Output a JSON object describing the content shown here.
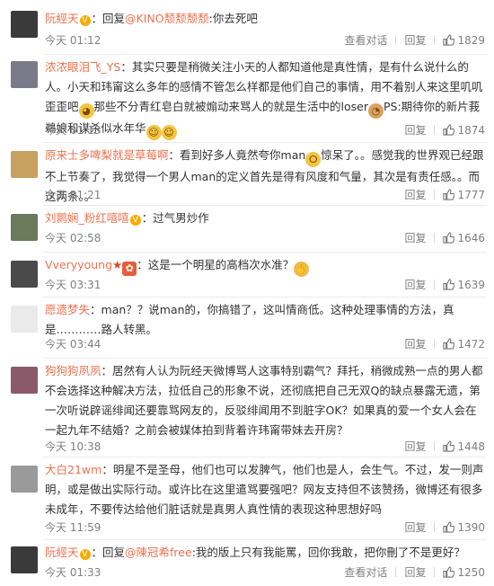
{
  "actions": {
    "view": "查看对话",
    "reply": "回复"
  },
  "comments": [
    {
      "avatar_color": "#3a3a3a",
      "name": "阮經天",
      "has_v": true,
      "text": "：回复",
      "mention": "@KINO颓颓颓颓",
      "text2": ":你去死吧",
      "time": "今天 01:12",
      "show_view": true,
      "likes": "1829"
    },
    {
      "avatar_color": "#7a7a8a",
      "name": "浓浓眼泪飞_YS",
      "text": "：其实只要是稍微关注小天的人都知道他是真性情，是有什么说什么的人。小天和玮甯这么多年的感情不管怎么样都是他们自己的事情，用不着别人来这里叽叽歪歪吧",
      "text2": "那些不分青红皂白就被煽动来骂人的就是生活中的loser",
      "text3": "PS:期待你的新片莪鵜娘和谋杀似水年华",
      "time": "今天 01:13",
      "show_view": false,
      "likes": "1874"
    },
    {
      "avatar_color": "#c8a060",
      "name": "原来士多啤梨就是草莓啊",
      "text": "：看到好多人竟然夸你man",
      "text2": "惊呆了。。感觉我的世界观已经跟不上节奏了，我觉得一个男人man的定义首先是得有风度和气量，其次是有责任感。。而这两条。。",
      "time": "今天 01:21",
      "show_view": false,
      "likes": "1777"
    },
    {
      "avatar_color": "#6a7a5a",
      "name": "刘鹮娴_粉红嘻嘻",
      "has_v": true,
      "text": "：过气男炒作",
      "time": "今天 02:58",
      "show_view": false,
      "likes": "1646"
    },
    {
      "avatar_color": "#4a4a4a",
      "name": "Vveryyoung",
      "text": "：这是一个明星的高档次水准？",
      "time": "今天 03:31",
      "show_view": false,
      "likes": "1639"
    },
    {
      "avatar_color": "#eaeaea",
      "name": "愿遗梦失",
      "text": "：man？？说man的，你搞错了，这叫情商低。这种处理事情的方法，真是…………路人转黑。",
      "time": "今天 03:44",
      "show_view": false,
      "likes": "1472"
    },
    {
      "avatar_color": "#8a5a6a",
      "name": "狗狗狗夙夙",
      "text": "：居然有人认为阮经天微博骂人这事特别霸气？拜托，稍微成熟一点的男人都不会选择这种解决方法，拉低自己的形象不说，还彻底把自己无双Q的缺点暴露无遗，第一次听说辟谣绯闻还要靠骂网友的，反驳绯闻用不到脏字OK？如果真的爱一个女人会在一起九年不结婚？之前会被媒体拍到背着许玮甯带妹去开房？",
      "time": "今天 10:38",
      "show_view": false,
      "likes": "1448"
    },
    {
      "avatar_color": "#9a9a9a",
      "name": "大白21wm",
      "text": "：明星不是圣母，他们也可以发脾气，他们也是人，会生气。不过，发一则声明，或是做出实际行动。或许比在这里遣骂要强吧？网友支持但不该赞扬，微博还有很多未成年，不要传达给他们脏话就是真男人真性情的表现这种思想好吗",
      "time": "今天 11:59",
      "show_view": false,
      "likes": "1390"
    },
    {
      "avatar_color": "#3a3a3a",
      "name": "阮經天",
      "has_v": true,
      "text": "：回复",
      "mention": "@陳冠希free",
      "text2": ":我的版上只有我能罵，回你我敢，把你刪了不是更好？",
      "time": "今天 01:33",
      "show_view": true,
      "likes": "1250"
    }
  ]
}
